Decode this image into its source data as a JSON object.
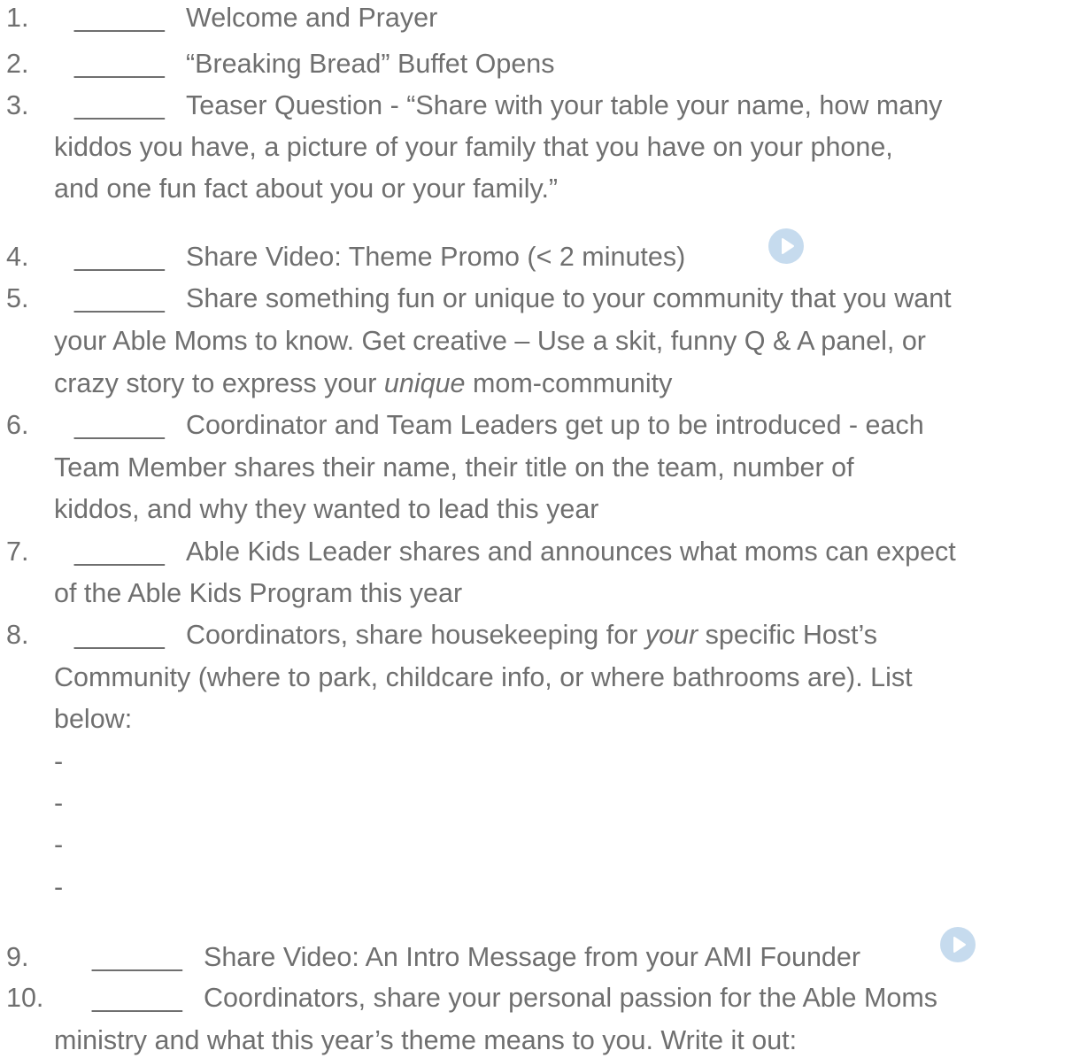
{
  "blank": "______",
  "items": [
    {
      "num": "1.",
      "text": "Welcome and Prayer"
    },
    {
      "num": "2.",
      "text": "“Breaking Bread” Buffet Opens"
    },
    {
      "num": "3.",
      "text": "Teaser Question - “Share with your table your name, how many",
      "cont": [
        "kiddos you have, a picture of your family that you have on your phone,",
        "and one fun fact about you or your family.”"
      ]
    },
    {
      "num": "4.",
      "text": "Share Video: Theme Promo (< 2 minutes)",
      "icon": "play-video-icon"
    },
    {
      "num": "5.",
      "text": "Share something fun or unique to your community that you want",
      "cont": [
        "your Able Moms to know. Get creative – Use a skit, funny Q & A panel, or"
      ],
      "cont_last_pre": "crazy story to express your ",
      "cont_last_em": "unique",
      "cont_last_post": " mom-community"
    },
    {
      "num": "6.",
      "text": "Coordinator and Team Leaders get up to be introduced - each",
      "cont": [
        "Team Member shares their name, their title on the team, number of",
        "kiddos, and why they wanted to lead this year"
      ]
    },
    {
      "num": "7.",
      "text": "Able Kids Leader shares and announces what moms can expect",
      "cont": [
        "of the Able Kids Program this year"
      ]
    },
    {
      "num": "8.",
      "text_pre": "Coordinators, share housekeeping for ",
      "text_em": "your",
      "text_post": " specific Host’s",
      "cont": [
        "Community (where to park, childcare info, or where bathrooms are). List",
        "below:"
      ],
      "dashes": [
        "-",
        "-",
        "-",
        "-"
      ]
    },
    {
      "num": "9.",
      "text": "Share Video: An Intro Message from your AMI Founder",
      "icon": "play-video-icon"
    },
    {
      "num": "10.",
      "text": "Coordinators, share your personal passion for the Able Moms",
      "cont": [
        "ministry and what this year’s theme means to you. Write it out:"
      ]
    }
  ],
  "colors": {
    "text": "#6f6f6f",
    "play_icon_bg": "#c6dbee",
    "play_icon_fg": "#ffffff"
  }
}
